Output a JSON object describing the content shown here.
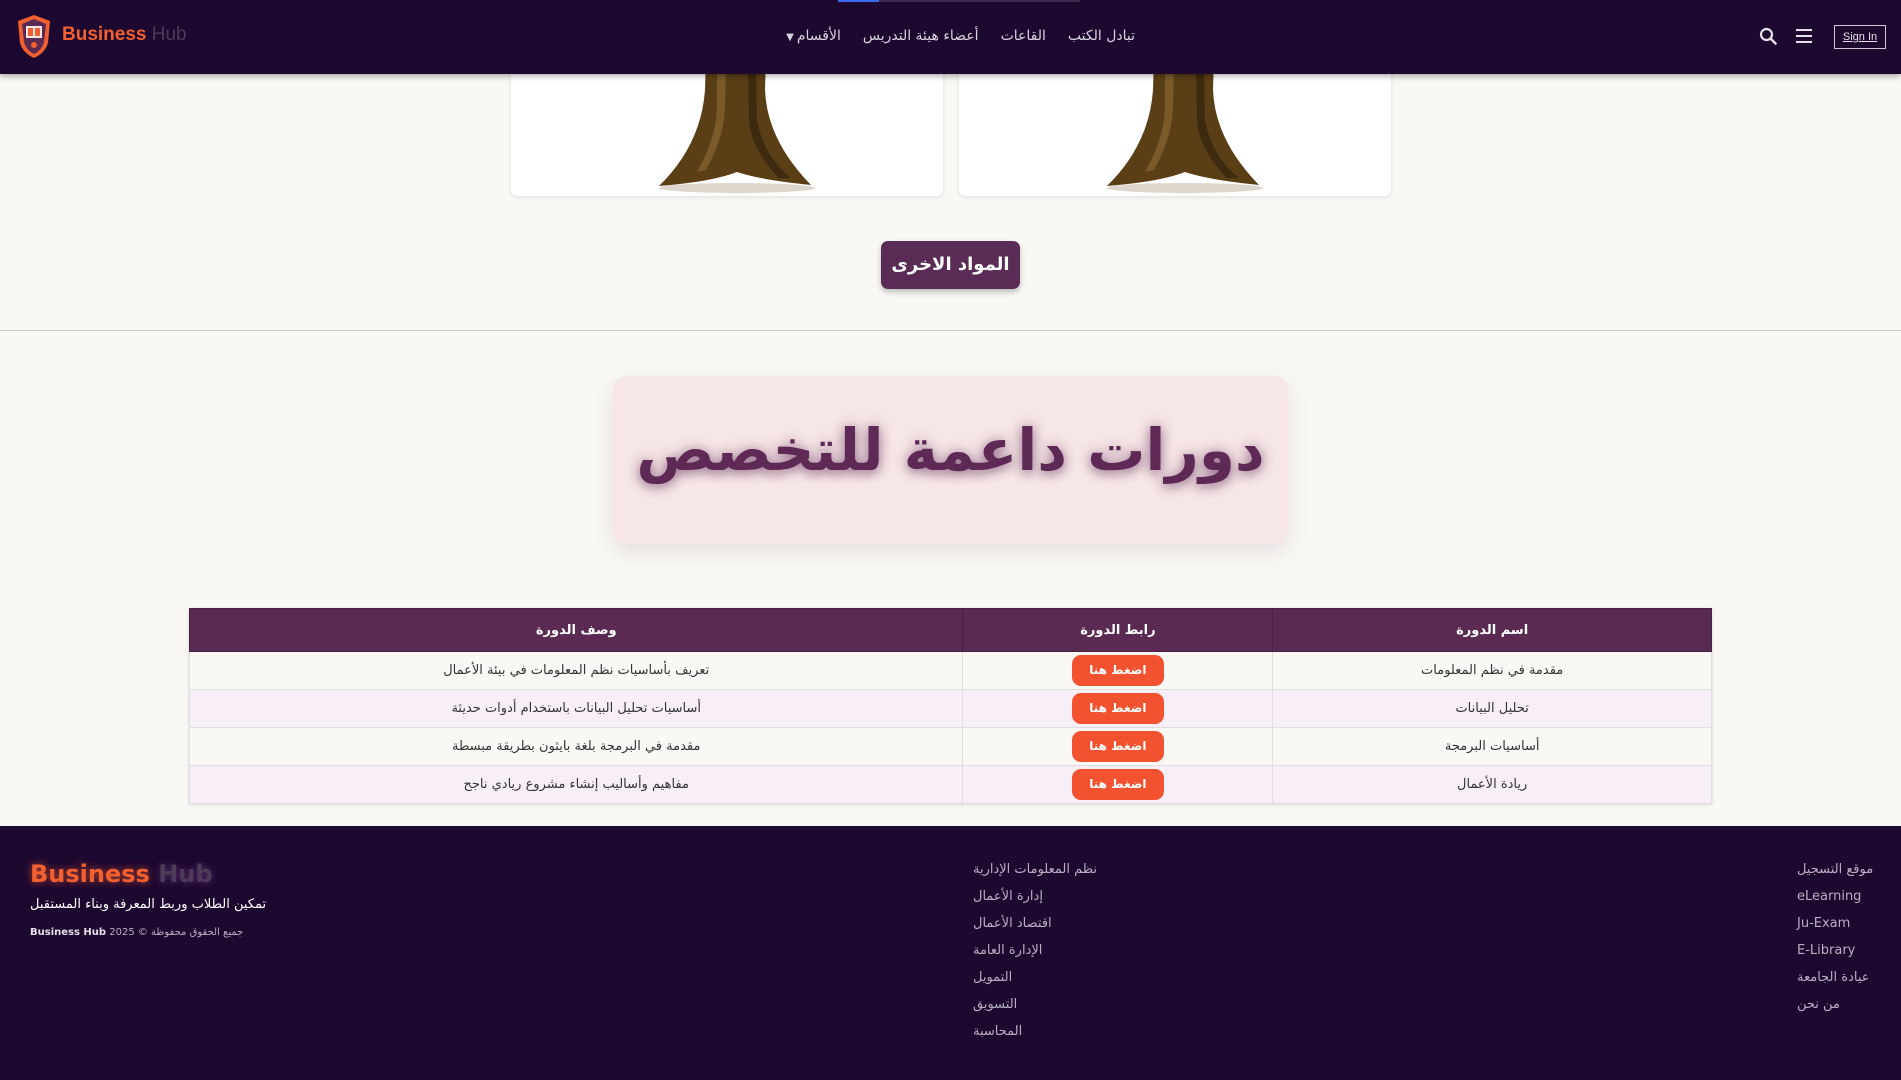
{
  "header": {
    "brand_part1": "Business",
    "brand_part2": "Hub",
    "nav": [
      {
        "label": "تبادل الكتب"
      },
      {
        "label": "القاعات"
      },
      {
        "label": "أعضاء هيئة التدريس"
      },
      {
        "label": "الأقسام",
        "dropdown": true
      }
    ],
    "signin_label": "Sign In",
    "scroll_progress": 0.17
  },
  "more_button": "المواد الاخرى",
  "section_title": "دورات داعمة للتخصص",
  "table": {
    "headers": [
      "اسم الدورة",
      "رابط الدورة",
      "وصف الدورة"
    ],
    "rows": [
      {
        "name": "مقدمة في نظم المعلومات",
        "link": "اضغط هنا",
        "desc": "تعريف بأساسيات نظم المعلومات في بيئة الأعمال"
      },
      {
        "name": "تحليل البيانات",
        "link": "اضغط هنا",
        "desc": "أساسيات تحليل البيانات باستخدام أدوات حديثة"
      },
      {
        "name": "أساسيات البرمجة",
        "link": "اضغط هنا",
        "desc": "مقدمة في البرمجة بلغة بايثون بطريقة مبسطة"
      },
      {
        "name": "ريادة الأعمال",
        "link": "اضغط هنا",
        "desc": "مفاهيم وأساليب إنشاء مشروع ريادي ناجح"
      }
    ]
  },
  "footer": {
    "brand_part1": "Business",
    "brand_part2": "Hub",
    "tagline": "تمكين الطلاب وربط المعرفة وبناء المستقبل",
    "copyright_brand": "Business Hub",
    "copyright_text": "جميع الحقوق محفوظة © 2025",
    "departments": [
      "نظم المعلومات الإدارية",
      "إدارة الأعمال",
      "اقتصاد الأعمال",
      "الإدارة العامة",
      "التمويل",
      "التسويق",
      "المحاسبة"
    ],
    "links": [
      "موقع التسجيل",
      "eLearning",
      "Ju-Exam",
      "E-Library",
      "عيادة الجامعة",
      "من نحن"
    ]
  },
  "colors": {
    "header_bg": "#1d0830",
    "accent_orange": "#f2522f",
    "primary_purple": "#5b2a52"
  }
}
